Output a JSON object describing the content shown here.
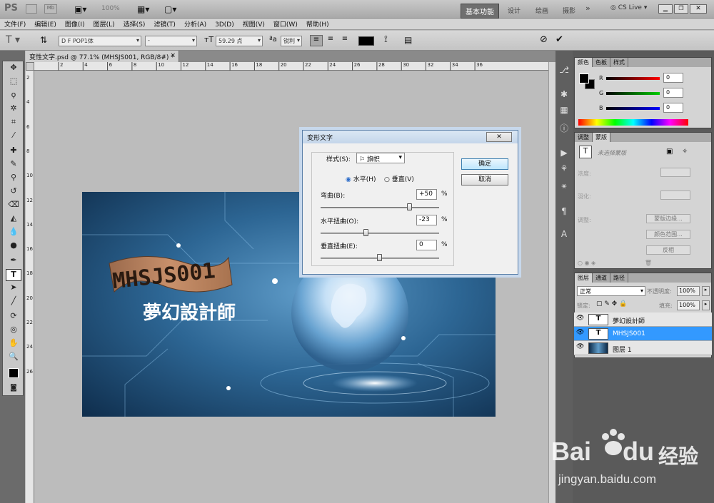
{
  "app": {
    "logo": "PS",
    "zoom": "100%",
    "workspaces": [
      "基本功能",
      "设计",
      "绘画",
      "摄影"
    ],
    "cslive": "CS Live"
  },
  "menu": [
    "文件(F)",
    "编辑(E)",
    "图像(I)",
    "图层(L)",
    "选择(S)",
    "滤镜(T)",
    "分析(A)",
    "3D(D)",
    "视图(V)",
    "窗口(W)",
    "帮助(H)"
  ],
  "options": {
    "font_family": "D F POP1体",
    "font_style": "-",
    "font_size": "59.29 点",
    "aa": "锐利"
  },
  "document": {
    "tab_title": "变性文字.psd @ 77.1% (MHSJS001, RGB/8#) *",
    "ruler_ticks": [
      "2",
      "4",
      "6",
      "8",
      "10",
      "12",
      "14",
      "16",
      "18",
      "20",
      "22",
      "24",
      "26",
      "28",
      "30",
      "32",
      "34",
      "36"
    ],
    "ruler_v_ticks": [
      "2",
      "4",
      "6",
      "8",
      "10",
      "12",
      "14",
      "16",
      "18",
      "20",
      "22",
      "24",
      "26"
    ]
  },
  "artwork": {
    "banner_text": "MHSJS001",
    "title_text": "夢幻設計師"
  },
  "dialog": {
    "title": "变形文字",
    "style_label": "样式(S):",
    "style_value": "旗帜",
    "horizontal_label": "水平(H)",
    "vertical_label": "垂直(V)",
    "bend_label": "弯曲(B):",
    "bend_value": "+50",
    "bend_fraction": 0.75,
    "hdist_label": "水平扭曲(O):",
    "hdist_value": "-23",
    "hdist_fraction": 0.385,
    "vdist_label": "垂直扭曲(E):",
    "vdist_value": "0",
    "vdist_fraction": 0.5,
    "percent": "%",
    "ok": "确定",
    "cancel": "取消"
  },
  "panels": {
    "color": {
      "tabs": [
        "颜色",
        "色板",
        "样式"
      ],
      "r_label": "R",
      "g_label": "G",
      "b_label": "B",
      "r": "0",
      "g": "0",
      "b": "0"
    },
    "masks": {
      "tabs": [
        "调整",
        "蒙版"
      ],
      "hint": "未选择蒙版",
      "density": "浓度:",
      "feather": "羽化:",
      "refine": "调整:",
      "edge_btn": "蒙版边缘...",
      "range_btn": "颜色范围...",
      "invert_btn": "反相"
    },
    "layers": {
      "tabs": [
        "图层",
        "通道",
        "路径"
      ],
      "blend": "正常",
      "opacity_label": "不透明度:",
      "opacity": "100%",
      "lock_label": "锁定:",
      "fill_label": "填充:",
      "fill": "100%",
      "items": [
        {
          "name": "夢幻設計師",
          "type": "T",
          "selected": false
        },
        {
          "name": "MHSJS001",
          "type": "T",
          "selected": true
        },
        {
          "name": "图层 1",
          "type": "img",
          "selected": false
        }
      ]
    }
  },
  "watermark": {
    "brand": "Bai",
    "brand2": "du",
    "cn": "经验",
    "url": "jingyan.baidu.com"
  },
  "colors": {
    "accent": "#3399ff",
    "annotation": "#e00000"
  }
}
